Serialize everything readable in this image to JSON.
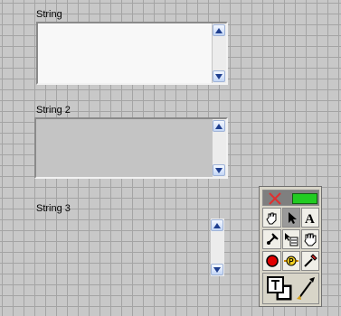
{
  "strings": [
    {
      "label": "String",
      "value": ""
    },
    {
      "label": "String 2",
      "value": ""
    },
    {
      "label": "String 3",
      "value": ""
    }
  ],
  "tools_palette": {
    "tools": [
      "automatic-tool-selection-icon",
      "operate-value-icon",
      "position-select-icon",
      "edit-text-icon",
      "connect-wire-icon",
      "object-shortcut-menu-icon",
      "scroll-window-icon",
      "set-clear-breakpoint-icon",
      "probe-data-icon",
      "get-color-icon",
      "set-color-icon"
    ],
    "colors": {
      "foreground": "#ffffff",
      "background": "#000000",
      "led": "#22cc22"
    }
  }
}
